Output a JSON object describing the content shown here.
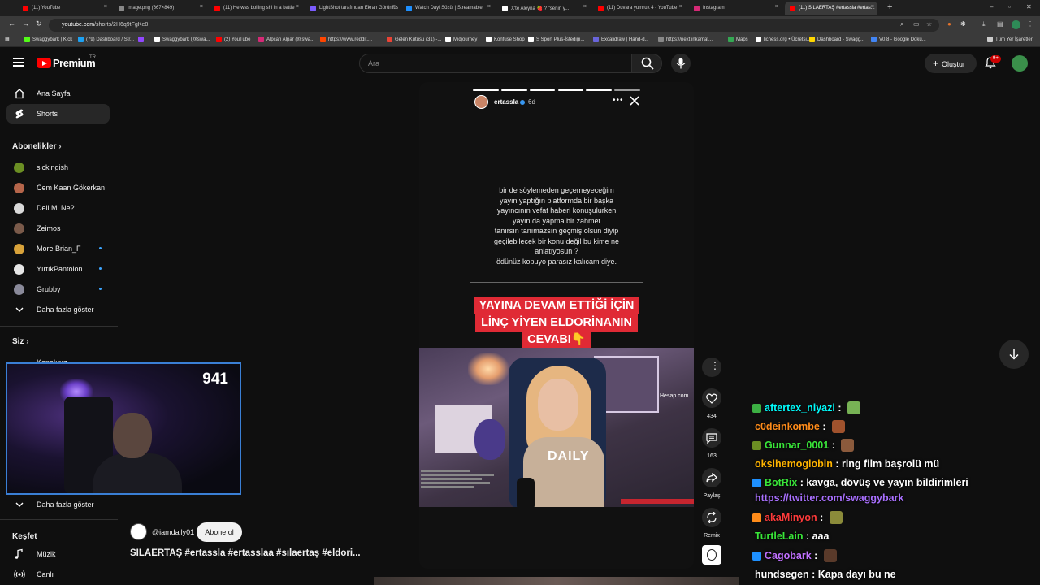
{
  "browser": {
    "tabs": [
      {
        "label": "(11) YouTube",
        "color": "#ff0000"
      },
      {
        "label": "image.png (667×849)",
        "color": "#888888"
      },
      {
        "label": "(11) He was boiling shi in a kettle",
        "color": "#ff0000"
      },
      {
        "label": "LightShot tarafından Ekran Görüntüsü",
        "color": "#7b5cff"
      },
      {
        "label": "Watch Dayi Sözül | Streamable",
        "color": "#1e90ff"
      },
      {
        "label": "X'te Aleyna 🍓 ? \"senin y...",
        "color": "#ffffff"
      },
      {
        "label": "(11) Duvara yumruk 4 - YouTube",
        "color": "#ff0000"
      },
      {
        "label": "Instagram",
        "color": "#d62976"
      },
      {
        "label": "(11) SILAERTAŞ #ertassla #ertas...",
        "color": "#ff0000"
      }
    ],
    "url_host": "youtube.com",
    "url_path": "/shorts/2H6q9tFgKe8",
    "bookmarks": [
      {
        "label": "Swaggybark | Kick",
        "color": "#53fc18"
      },
      {
        "label": "(79) Dashboard / Str...",
        "color": "#1da1f2"
      },
      {
        "label": "",
        "color": "#9147ff"
      },
      {
        "label": "Swaggybark (@swa...",
        "color": "#ffffff"
      },
      {
        "label": "(2) YouTube",
        "color": "#ff0000"
      },
      {
        "label": "Alpcan Alpar (@swa...",
        "color": "#d62976"
      },
      {
        "label": "https://www.reddit....",
        "color": "#ff4500"
      },
      {
        "label": "Gelen Kutusu (31) -...",
        "color": "#ea4335"
      },
      {
        "label": "Midjourney",
        "color": "#ffffff"
      },
      {
        "label": "Konfuse Shop",
        "color": "#ffffff"
      },
      {
        "label": "S Sport Plus-İstediği...",
        "color": "#ffffff"
      },
      {
        "label": "Excalidraw | Hand-d...",
        "color": "#6965db"
      },
      {
        "label": "https://next.inkamat...",
        "color": "#888888"
      },
      {
        "label": "Maps",
        "color": "#34a853"
      },
      {
        "label": "lichess.org • Ücretsi...",
        "color": "#ffffff"
      },
      {
        "label": "Dashboard - Swagg...",
        "color": "#ffd700"
      },
      {
        "label": "V0.8 - Google Dokü...",
        "color": "#4285f4"
      },
      {
        "label": "Tüm Yer İşaretleri",
        "color": "#cccccc"
      }
    ]
  },
  "header": {
    "brand": "Premium",
    "region": "TR",
    "search_placeholder": "Ara",
    "create_label": "Oluştur",
    "notif_count": "9+"
  },
  "sidebar": {
    "main": [
      {
        "label": "Ana Sayfa",
        "icon": "home-icon"
      },
      {
        "label": "Shorts",
        "icon": "shorts-icon"
      }
    ],
    "subscriptions_heading": "Abonelikler",
    "subscriptions": [
      {
        "label": "sickingish",
        "color": "#6b8e23",
        "live": false
      },
      {
        "label": "Cem Kaan Gökerkan",
        "color": "#b5654a",
        "live": false
      },
      {
        "label": "Deli Mi Ne?",
        "color": "#d9d9d9",
        "live": false
      },
      {
        "label": "Zeimos",
        "color": "#7a5a4a",
        "live": false
      },
      {
        "label": "More Brian_F",
        "color": "#d8a23a",
        "live": true
      },
      {
        "label": "YırtıkPantolon",
        "color": "#e6e6e6",
        "live": true
      },
      {
        "label": "Grubby",
        "color": "#8a8a9a",
        "live": true
      }
    ],
    "show_more": "Daha fazla göster",
    "you_heading": "Siz",
    "you_partial": "Kanalınız",
    "show_more_2": "Daha fazla göster",
    "explore_heading": "Keşfet",
    "explore": [
      {
        "label": "Müzik",
        "icon": "music-icon"
      },
      {
        "label": "Canlı",
        "icon": "live-icon"
      }
    ]
  },
  "webcam": {
    "viewer_count": "941"
  },
  "short": {
    "story_user": "ertassla",
    "story_age": "6d",
    "story_text": "bir de söylemeden geçemeyeceğim\nyayın yaptığın platformda bir başka\nyayıncının vefat haberi konuşulurken\nyayın da yapma bir zahmet\ntanırsın tanımazsın geçmiş olsun diyip\ngeçilebilecek bir konu değil bu kime ne\nanlatıyosun ?\nödünüz kopuyo parasız kalıcam diye.",
    "headline_lines": [
      "YAYINA DEVAM ETTİĞİ İÇİN",
      "LİNÇ YİYEN ELDORİNANIN",
      "CEVABI👇"
    ],
    "video_watermark": "Hesap.com",
    "video_caption": "DAILY",
    "progress_segments": 6,
    "progress_done": 5
  },
  "actions": {
    "likes": "434",
    "comments": "163",
    "share": "Paylaş",
    "remix": "Remix"
  },
  "meta": {
    "channel": "@iamdaily01",
    "subscribe": "Abone ol",
    "title": "SILAERTAŞ #ertassla #ertasslaa #sılaertaş #eldori..."
  },
  "chat": [
    {
      "user": "aftertex_niyazi",
      "user_color": "#00ffff",
      "msg": "",
      "badge_color": "#3cb043",
      "emote_color": "#77b255"
    },
    {
      "user": "c0deinkombe",
      "user_color": "#ff8c1a",
      "msg": "",
      "badge_color": "",
      "emote_color": "#a0522d"
    },
    {
      "user": "Gunnar_0001",
      "user_color": "#39e639",
      "msg": "",
      "badge_color": "#6b8e23",
      "emote_color": "#8b5a3c"
    },
    {
      "user": "oksihemoglobin",
      "user_color": "#ffb400",
      "msg": "ring film başrolü mü",
      "badge_color": "",
      "emote_color": ""
    },
    {
      "user": "BotRix",
      "user_color": "#39e639",
      "msg": "kavga, dövüş ve yayın bildirimleri",
      "badge_color": "#1e90ff",
      "emote_color": ""
    },
    {
      "user": "",
      "user_color": "#a970ff",
      "msg": "https://twitter.com/swaggybark",
      "badge_color": "",
      "emote_color": ""
    },
    {
      "user": "akaMinyon",
      "user_color": "#ff3b3b",
      "msg": "",
      "badge_color": "#ff8c1a",
      "emote_color": "#8b8b3a"
    },
    {
      "user": "TurtleLain",
      "user_color": "#39e639",
      "msg": "aaa",
      "badge_color": "",
      "emote_color": ""
    },
    {
      "user": "Cagobark",
      "user_color": "#c070ff",
      "msg": "",
      "badge_color": "#1e90ff",
      "emote_color": "#5a3a2a"
    },
    {
      "user": "hundsegen",
      "user_color": "#ffffff",
      "msg": "Kapa dayı bu ne",
      "badge_color": "",
      "emote_color": ""
    }
  ]
}
